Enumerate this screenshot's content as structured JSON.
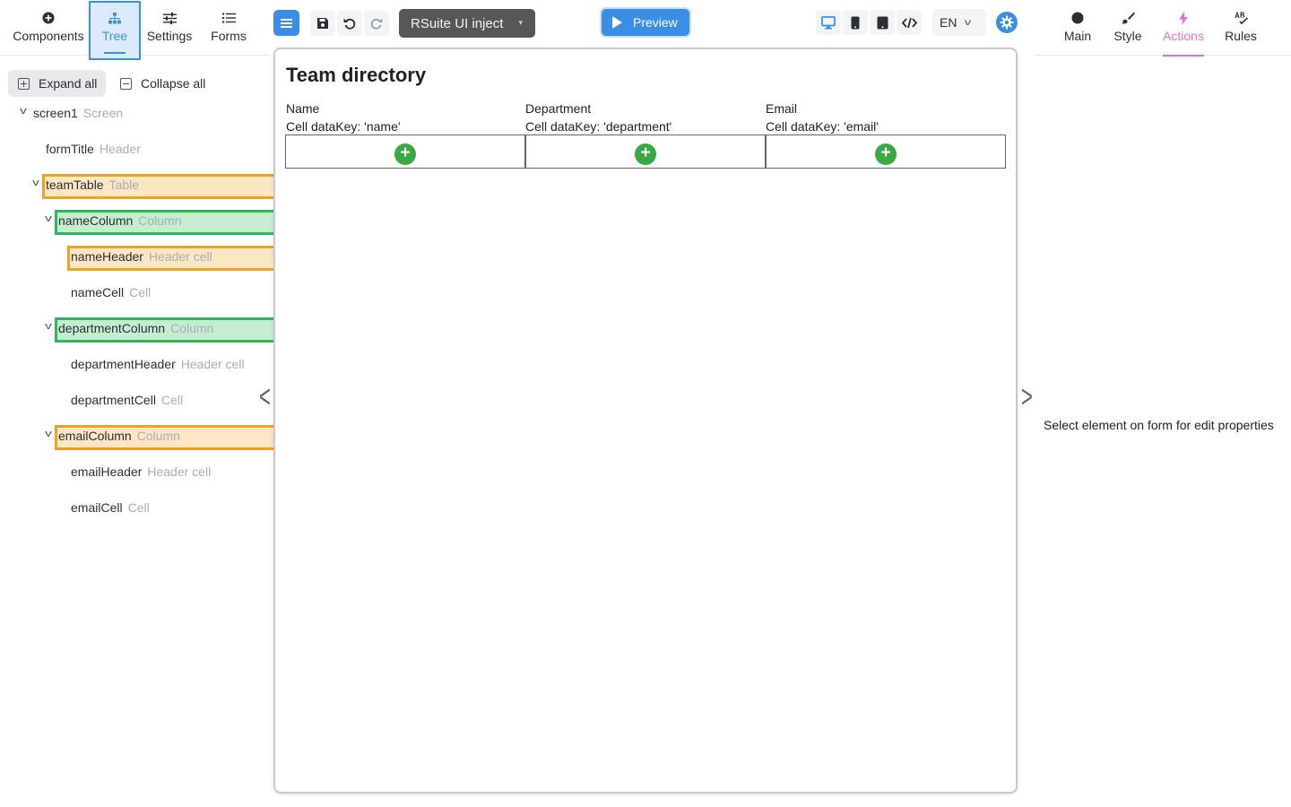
{
  "left_tabs": [
    {
      "label": "Components",
      "icon": "plus-circle-icon"
    },
    {
      "label": "Tree",
      "icon": "sitemap-icon"
    },
    {
      "label": "Settings",
      "icon": "sliders-icon"
    },
    {
      "label": "Forms",
      "icon": "list-icon"
    }
  ],
  "tree_actions": {
    "expand_all": "Expand all",
    "collapse_all": "Collapse all"
  },
  "tree": [
    {
      "name": "screen1",
      "type": "Screen",
      "expanded": true
    },
    {
      "name": "formTitle",
      "type": "Header"
    },
    {
      "name": "teamTable",
      "type": "Table",
      "expanded": true,
      "highlight": "orange"
    },
    {
      "name": "nameColumn",
      "type": "Column",
      "expanded": true,
      "highlight": "green"
    },
    {
      "name": "nameHeader",
      "type": "Header cell",
      "highlight": "orange"
    },
    {
      "name": "nameCell",
      "type": "Cell"
    },
    {
      "name": "departmentColumn",
      "type": "Column",
      "expanded": true,
      "highlight": "green"
    },
    {
      "name": "departmentHeader",
      "type": "Header cell"
    },
    {
      "name": "departmentCell",
      "type": "Cell"
    },
    {
      "name": "emailColumn",
      "type": "Column",
      "expanded": true,
      "highlight": "orange"
    },
    {
      "name": "emailHeader",
      "type": "Header cell"
    },
    {
      "name": "emailCell",
      "type": "Cell"
    }
  ],
  "toolbar": {
    "theme": "RSuite UI inject",
    "preview": "Preview",
    "language": "EN"
  },
  "canvas": {
    "form_title": "Team directory",
    "columns": [
      {
        "header": "Name",
        "cell": "Cell dataKey: 'name'"
      },
      {
        "header": "Department",
        "cell": "Cell dataKey: 'department'"
      },
      {
        "header": "Email",
        "cell": "Cell dataKey: 'email'"
      }
    ]
  },
  "right_tabs": [
    {
      "label": "Main",
      "icon": "circle-icon"
    },
    {
      "label": "Style",
      "icon": "brush-icon"
    },
    {
      "label": "Actions",
      "icon": "lightning-icon"
    },
    {
      "label": "Rules",
      "icon": "spellcheck-icon"
    }
  ],
  "right_panel": {
    "message": "Select element on form for edit properties"
  },
  "colors": {
    "accent": "#3b8ee6",
    "actions_tab": "#dd6fe0",
    "add_button": "#3aa943",
    "highlight_orange": "#f0a21e",
    "highlight_green": "#2fb75b"
  }
}
